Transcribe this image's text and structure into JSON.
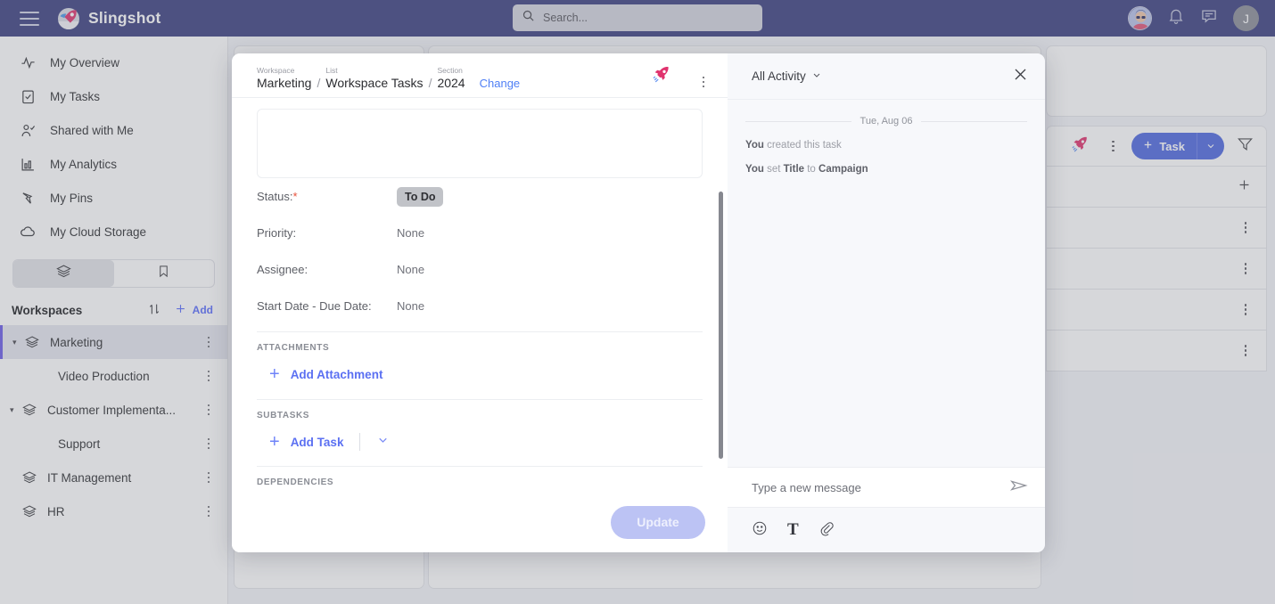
{
  "app": {
    "brand_name": "Slingshot",
    "logo_icon": "rocket-logo-icon",
    "menu_icon": "hamburger-menu-icon"
  },
  "topbar": {
    "search": {
      "placeholder": "Search...",
      "value": "",
      "icon": "search-icon"
    },
    "notifications_icon": "bell-icon",
    "messages_icon": "chat-bubble-icon",
    "profile_avatar_icon": "user-avatar-icon",
    "account_initial": "J"
  },
  "sidebar": {
    "nav_items": [
      {
        "label": "My Overview",
        "icon": "activity-pulse-icon"
      },
      {
        "label": "My Tasks",
        "icon": "clipboard-check-icon"
      },
      {
        "label": "Shared with Me",
        "icon": "user-check-icon"
      },
      {
        "label": "My Analytics",
        "icon": "bar-chart-icon"
      },
      {
        "label": "My Pins",
        "icon": "pin-icon"
      },
      {
        "label": "My Cloud Storage",
        "icon": "cloud-icon"
      }
    ],
    "segmented": [
      {
        "icon": "layers-icon",
        "active": true
      },
      {
        "icon": "bookmark-icon",
        "active": false
      }
    ],
    "workspaces_header": {
      "title": "Workspaces",
      "sort_icon": "sort-arrows-icon",
      "add_icon": "plus-icon",
      "add_label": "Add"
    },
    "workspaces": [
      {
        "label": "Marketing",
        "level": 0,
        "expandable": true,
        "selected": true
      },
      {
        "label": "Video Production",
        "level": 1,
        "expandable": false,
        "selected": false
      },
      {
        "label": "Customer Implementa...",
        "level": 0,
        "expandable": true,
        "selected": false
      },
      {
        "label": "Support",
        "level": 1,
        "expandable": false,
        "selected": false
      },
      {
        "label": "IT Management",
        "level": 0,
        "expandable": false,
        "selected": false
      },
      {
        "label": "HR",
        "level": 0,
        "expandable": false,
        "selected": false
      }
    ]
  },
  "background_panel": {
    "rocket_icon": "rocket-icon",
    "more_icon": "kebab-menu-icon",
    "task_button_label": "Task",
    "task_button_plus_icon": "plus-icon",
    "task_button_chevron_icon": "chevron-down-icon",
    "filter_icon": "funnel-filter-icon",
    "add_row_icon": "plus-icon",
    "accent_color": "#5069e0"
  },
  "modal": {
    "breadcrumb": [
      {
        "caption": "Workspace",
        "value": "Marketing"
      },
      {
        "caption": "List",
        "value": "Workspace Tasks"
      },
      {
        "caption": "Section",
        "value": "2024"
      }
    ],
    "change_link": "Change",
    "rocket_icon": "rocket-icon",
    "more_icon": "kebab-menu-icon",
    "description": {
      "value": "",
      "placeholder": ""
    },
    "fields": [
      {
        "label": "Status:",
        "required": true,
        "value": "To Do",
        "type": "chip"
      },
      {
        "label": "Priority:",
        "required": false,
        "value": "None",
        "type": "text"
      },
      {
        "label": "Assignee:",
        "required": false,
        "value": "None",
        "type": "text"
      },
      {
        "label": "Start Date - Due Date:",
        "required": false,
        "value": "None",
        "type": "text"
      }
    ],
    "sections": [
      {
        "title": "ATTACHMENTS",
        "action_label": "Add Attachment",
        "has_chevron": false
      },
      {
        "title": "SUBTASKS",
        "action_label": "Add Task",
        "has_chevron": true
      },
      {
        "title": "DEPENDENCIES",
        "action_label": "",
        "has_chevron": false
      }
    ],
    "update_button": "Update"
  },
  "activity": {
    "filter_label": "All Activity",
    "filter_chevron_icon": "chevron-down-icon",
    "close_icon": "close-x-icon",
    "day_separator": "Tue, Aug 06",
    "entries": [
      {
        "actor": "You",
        "text": " created this task",
        "bold_parts": []
      },
      {
        "actor": "You",
        "text": " set ",
        "bold_mid": "Title",
        "text2": " to ",
        "bold_end": "Campaign"
      }
    ],
    "message_input": {
      "placeholder": "Type a new message",
      "value": ""
    },
    "send_icon": "send-paper-plane-icon",
    "tools": [
      {
        "icon": "emoji-smiley-icon"
      },
      {
        "icon": "text-format-icon",
        "glyph": "T"
      },
      {
        "icon": "paperclip-attachment-icon"
      }
    ]
  }
}
